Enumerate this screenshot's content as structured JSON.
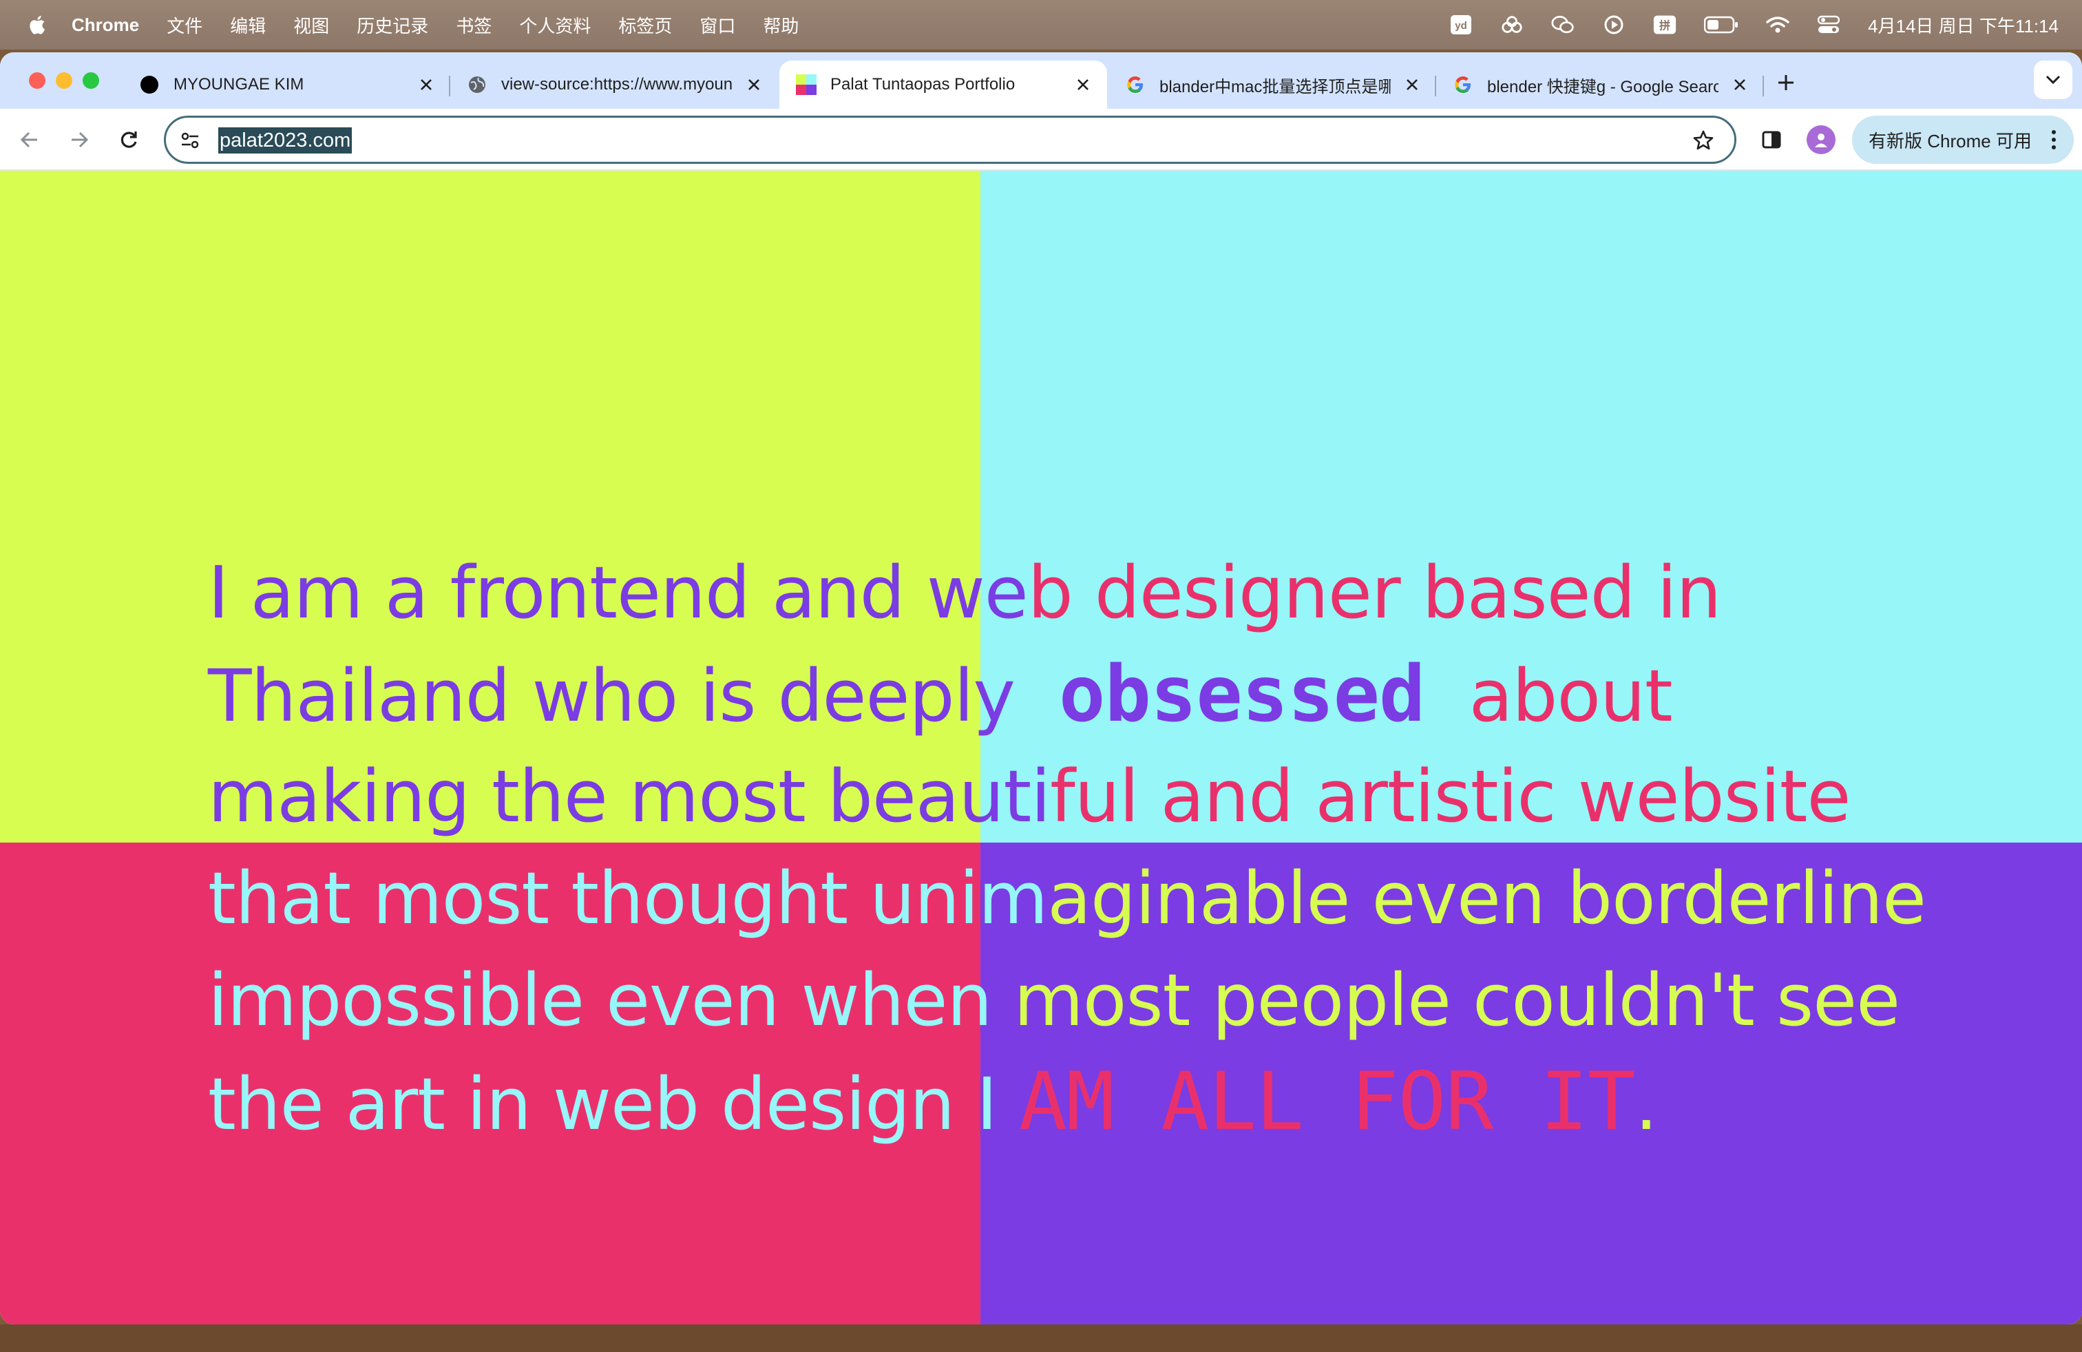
{
  "menubar": {
    "app_name": "Chrome",
    "items": [
      "文件",
      "编辑",
      "视图",
      "历史记录",
      "书签",
      "个人资料",
      "标签页",
      "窗口",
      "帮助"
    ],
    "status_icons": [
      "youdao-icon",
      "creative-cloud-icon",
      "wechat-icon",
      "play-circle-icon",
      "input-method-icon",
      "battery-icon",
      "wifi-icon",
      "control-center-icon"
    ],
    "input_method_label": "拼",
    "youdao_label": "yd",
    "clock": "4月14日 周日 下午11:14"
  },
  "tabs": [
    {
      "title": "MYOUNGAE KIM",
      "icon": "black-circle-favicon",
      "active": false
    },
    {
      "title": "view-source:https://www.myoungaekim.com",
      "icon": "globe-icon",
      "active": false
    },
    {
      "title": "Palat Tuntaopas Portfolio",
      "icon": "palat-favicon",
      "active": true
    },
    {
      "title": "blander中mac批量选择顶点是哪个键",
      "icon": "google-icon",
      "active": false
    },
    {
      "title": "blender 快捷键g - Google Search",
      "icon": "google-icon",
      "active": false
    }
  ],
  "toolbar": {
    "url": "palat2023.com",
    "update_label": "有新版 Chrome 可用"
  },
  "colors": {
    "lime": "#d7fd51",
    "cyan": "#96f6f8",
    "pink": "#ea306b",
    "purple": "#7b3ce3"
  },
  "statement": {
    "line1": [
      "I am a frontend and we",
      "b designer based in"
    ],
    "line2": [
      "Thailand who is deeply  ",
      "obsessed",
      "  about"
    ],
    "line3": [
      "making the most beauti",
      "ful and artistic website"
    ],
    "line4": [
      "that most thought unim",
      "aginable even borderline"
    ],
    "line5": [
      "impossible even when ",
      "most people couldn't see"
    ],
    "line6": [
      "the art in web design I ",
      "AM ALL FOR IT",
      "."
    ]
  }
}
